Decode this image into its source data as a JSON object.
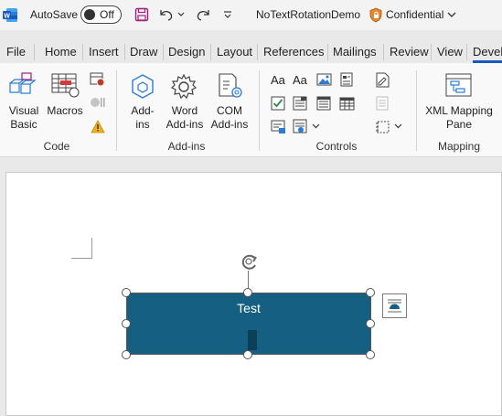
{
  "titlebar": {
    "app_icon": "word-logo-icon",
    "autosave_label": "AutoSave",
    "toggle_state": "Off",
    "doc_title": "NoTextRotationDemo",
    "sensitivity_label": "Confidential"
  },
  "tabs": [
    "File",
    "Home",
    "Insert",
    "Draw",
    "Design",
    "Layout",
    "References",
    "Mailings",
    "Review",
    "View",
    "Devel"
  ],
  "active_tab": "Devel",
  "ribbon": {
    "code": {
      "group_label": "Code",
      "visual_basic_line1": "Visual",
      "visual_basic_line2": "Basic",
      "macros_label": "Macros"
    },
    "addins": {
      "group_label": "Add-ins",
      "addins_line1": "Add-",
      "addins_line2": "ins",
      "word_addins_line1": "Word",
      "word_addins_line2": "Add-ins",
      "com_addins_line1": "COM",
      "com_addins_line2": "Add-ins"
    },
    "controls": {
      "group_label": "Controls",
      "aa_rich": "Aa",
      "aa_plain": "Aa"
    },
    "mapping": {
      "group_label": "Mapping",
      "xml_line1": "XML Mapping",
      "xml_line2": "Pane"
    }
  },
  "document": {
    "shape_text": "Test",
    "shape_fill": "#155f82"
  },
  "colors": {
    "accent": "#185abd",
    "shape": "#155f82"
  }
}
